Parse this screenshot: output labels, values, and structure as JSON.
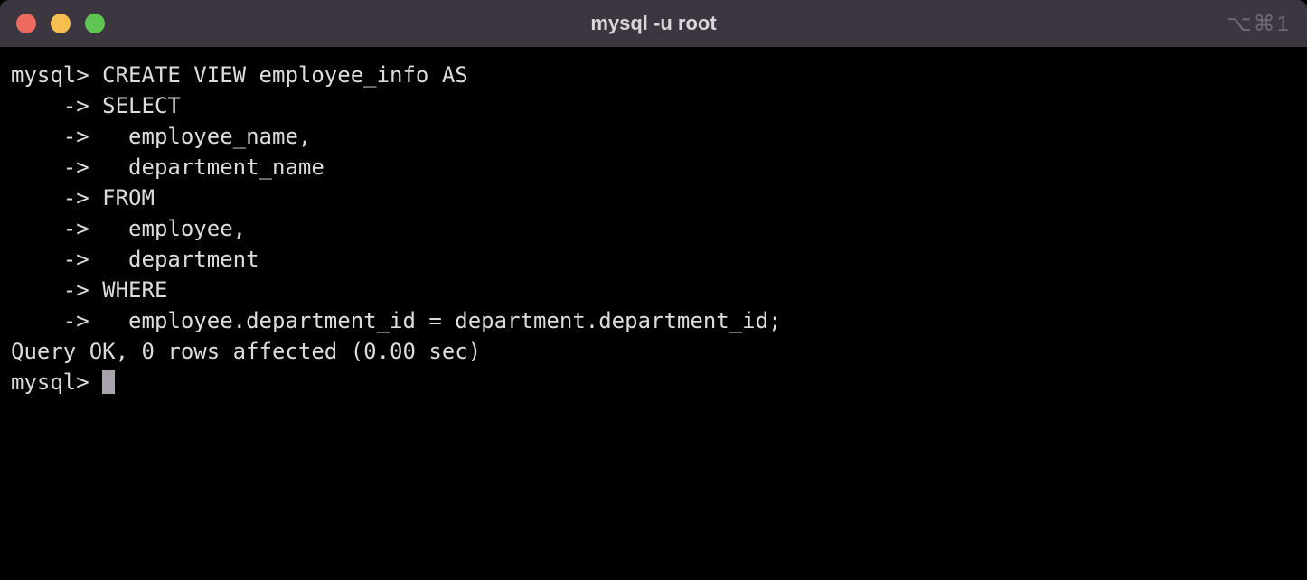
{
  "window": {
    "title": "mysql -u root",
    "shortcut_indicator": "⌥⌘1"
  },
  "terminal": {
    "prompt": "mysql>",
    "continuation": "->",
    "lines": [
      {
        "prefix": "mysql>",
        "text": " CREATE VIEW employee_info AS"
      },
      {
        "prefix": "    ->",
        "text": " SELECT"
      },
      {
        "prefix": "    ->",
        "text": "   employee_name,"
      },
      {
        "prefix": "    ->",
        "text": "   department_name"
      },
      {
        "prefix": "    ->",
        "text": " FROM"
      },
      {
        "prefix": "    ->",
        "text": "   employee,"
      },
      {
        "prefix": "    ->",
        "text": "   department"
      },
      {
        "prefix": "    ->",
        "text": " WHERE"
      },
      {
        "prefix": "    ->",
        "text": "   employee.department_id = department.department_id;"
      }
    ],
    "result": "Query OK, 0 rows affected (0.00 sec)",
    "blank": "",
    "next_prompt": "mysql> "
  }
}
